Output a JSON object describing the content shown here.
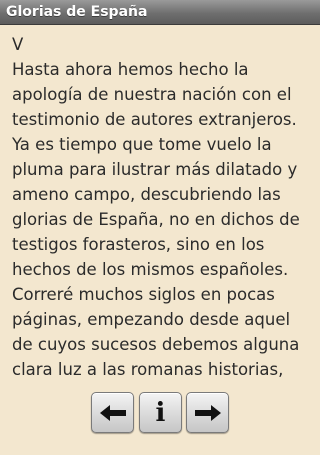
{
  "window": {
    "title": "Glorias de España"
  },
  "content": {
    "lines": [
      "V",
      "Hasta ahora hemos hecho la",
      "apología de nuestra nación con el",
      "testimonio de autores extranjeros.",
      "Ya es tiempo que tome vuelo la",
      "pluma para ilustrar más dilatado y",
      "ameno campo, descubriendo las",
      "glorias de España, no en dichos de",
      "testigos forasteros, sino en los",
      "hechos de los mismos españoles.",
      "Correré muchos siglos en pocas",
      "páginas, empezando desde aquel",
      "de cuyos sucesos debemos alguna",
      "clara luz a las romanas historias,"
    ]
  },
  "controls": {
    "prev_icon": "arrow-left-icon",
    "info_icon": "info-icon",
    "info_glyph": "i",
    "next_icon": "arrow-right-icon"
  },
  "colors": {
    "background": "#f3e7cf",
    "text": "#2b2b2b",
    "titlebar": "#6f6f6f"
  }
}
